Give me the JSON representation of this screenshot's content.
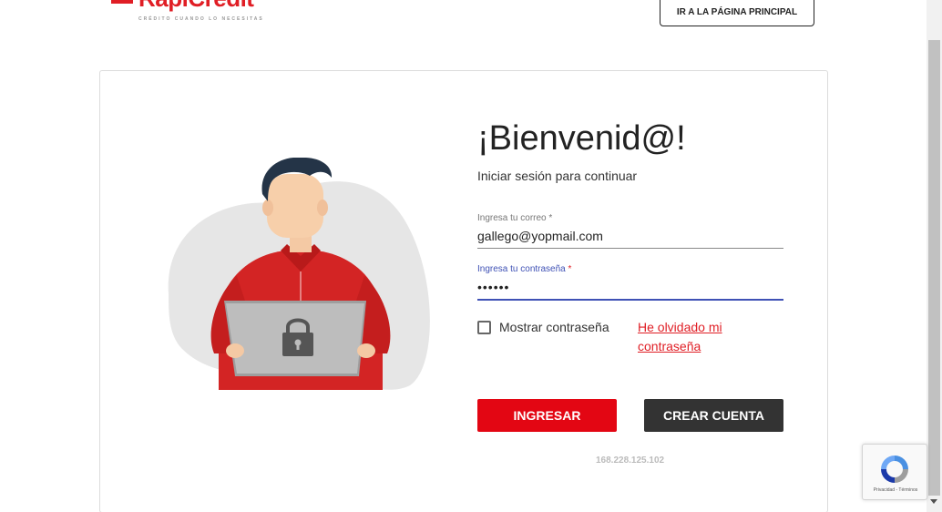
{
  "header": {
    "logo_text": "RapiCredit",
    "logo_tagline": "CRÉDITO CUANDO LO NECESITAS",
    "home_button_label": "IR A LA PÁGINA PRINCIPAL"
  },
  "login": {
    "title": "¡Bienvenid@!",
    "subtitle": "Iniciar sesión para continuar",
    "email": {
      "label": "Ingresa tu correo",
      "required_mark": "*",
      "value": "gallego@yopmail.com"
    },
    "password": {
      "label": "Ingresa tu contraseña",
      "required_mark": "*",
      "value": "123456"
    },
    "show_password_label": "Mostrar contraseña",
    "show_password_checked": false,
    "forgot_password_label": "He olvidado mi contraseña",
    "login_button_label": "INGRESAR",
    "create_account_button_label": "CREAR CUENTA",
    "ip_address": "168.228.125.102"
  },
  "recaptcha": {
    "links_text": "Privacidad - Términos"
  },
  "colors": {
    "brand_red": "#e30613",
    "dark_button": "#333333",
    "focus_blue": "#3f51b5"
  },
  "icons": {
    "illustration": "man-with-laptop-lock",
    "lock": "lock-icon",
    "recaptcha": "recaptcha-icon"
  }
}
